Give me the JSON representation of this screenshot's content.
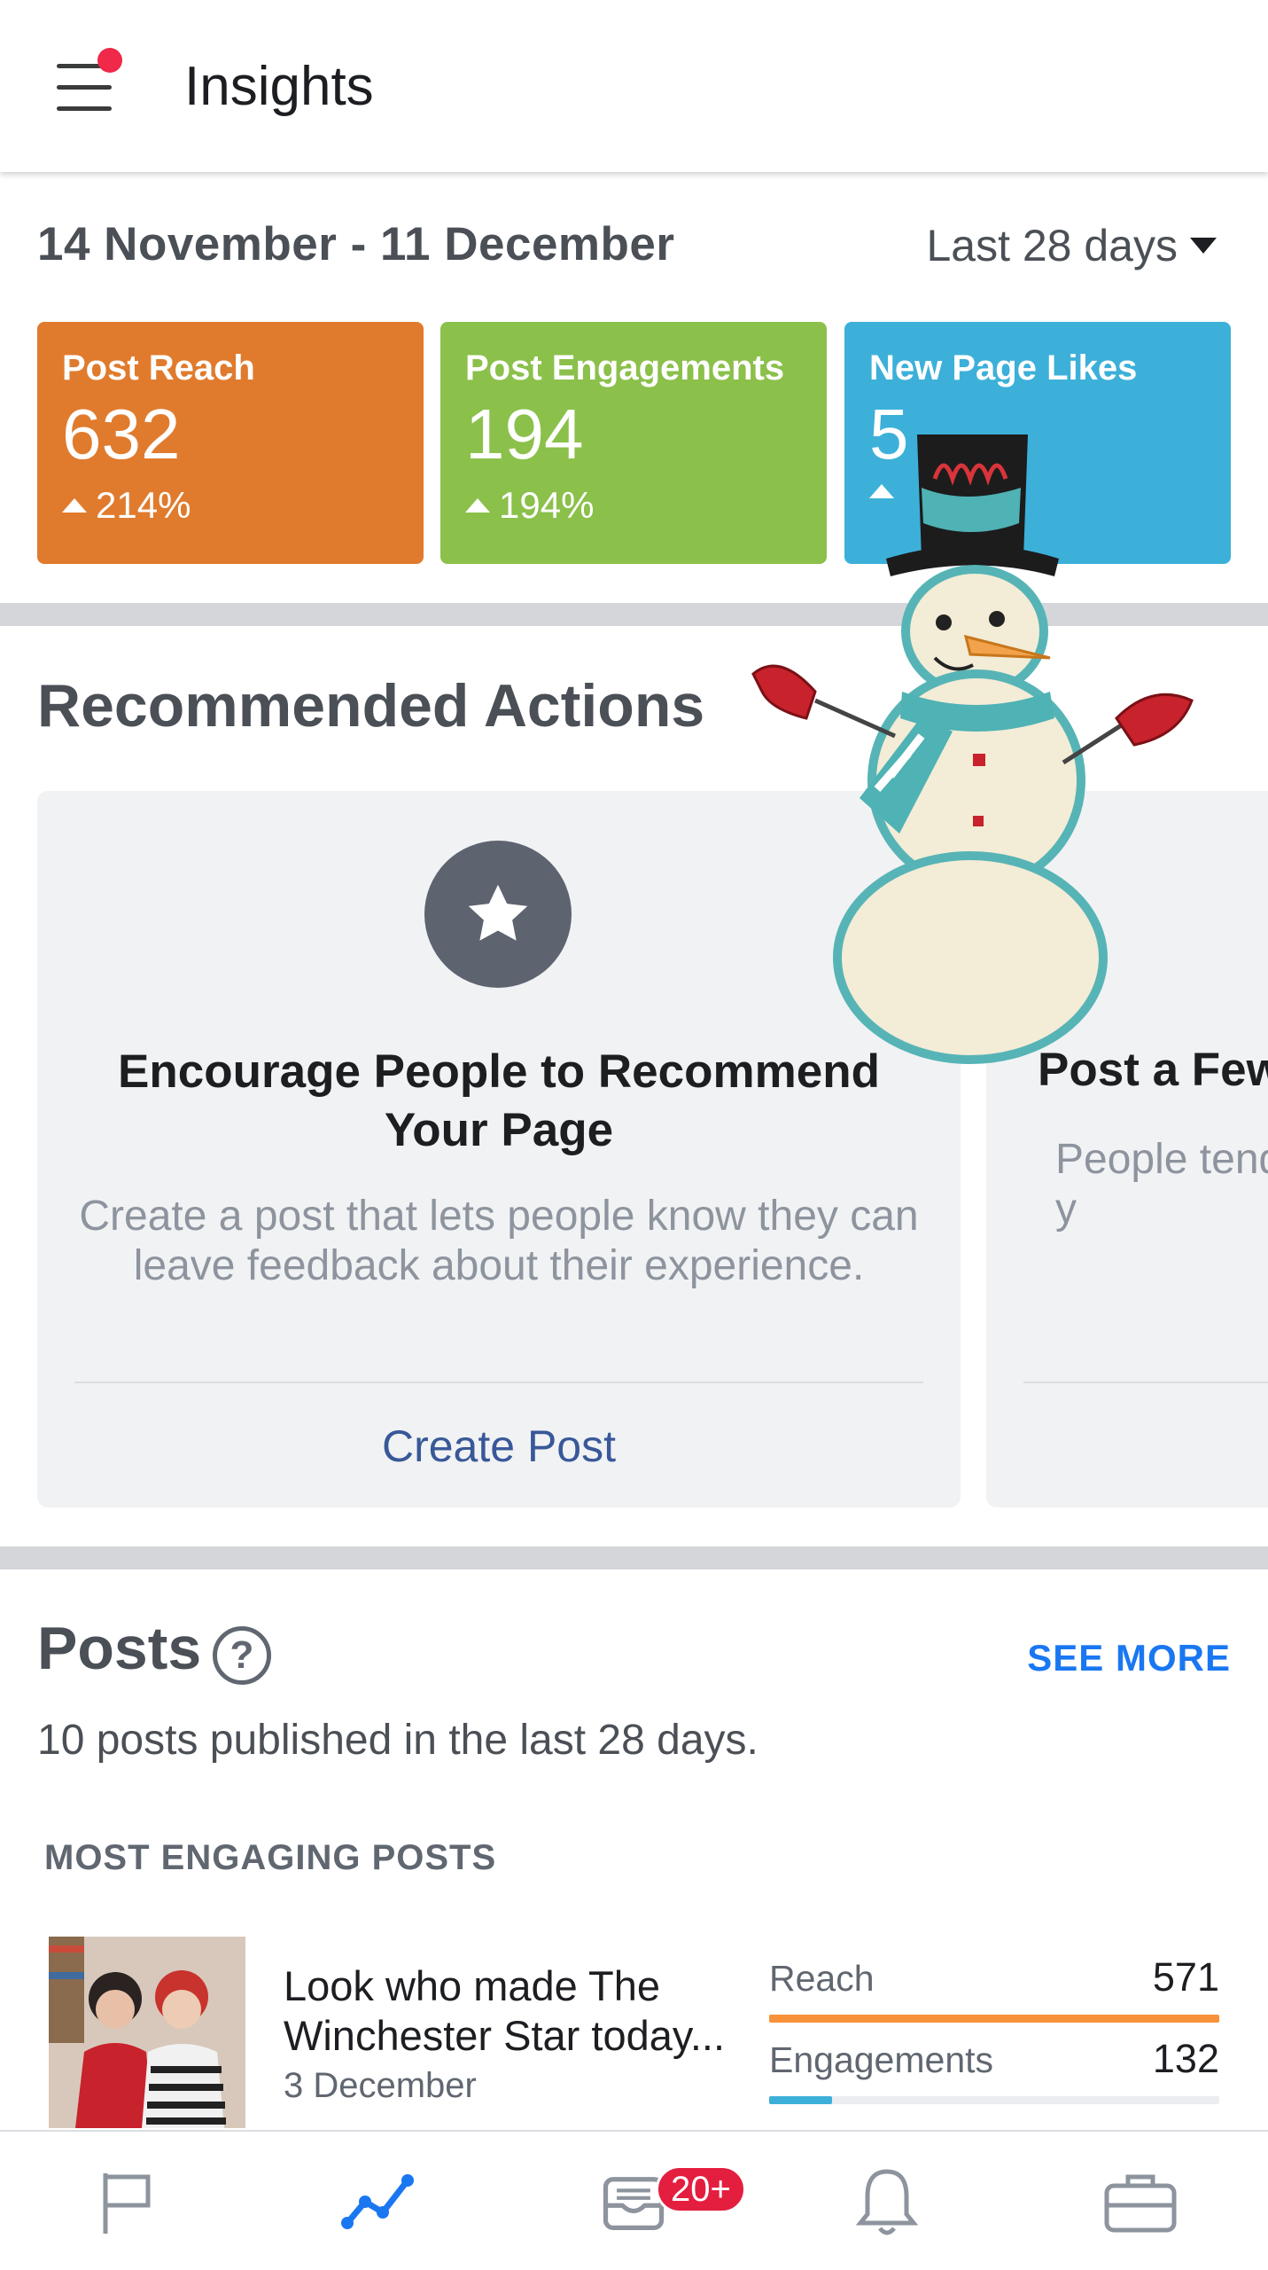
{
  "header": {
    "title": "Insights",
    "menu_icon": "hamburger-menu-icon",
    "notification_dot_color": "#f02849"
  },
  "date_range": {
    "label": "14 November - 11 December",
    "period": "Last 28 days"
  },
  "stats": [
    {
      "label": "Post Reach",
      "value": "632",
      "change": "214%",
      "color": "#e07b2e"
    },
    {
      "label": "Post Engagements",
      "value": "194",
      "change": "194%",
      "color": "#8bc04b"
    },
    {
      "label": "New Page Likes",
      "value": "5",
      "change": "",
      "color": "#3cb0d9"
    }
  ],
  "recommended": {
    "title": "Recommended Actions",
    "cards": [
      {
        "icon": "star-icon",
        "heading": "Encourage People to Recommend Your Page",
        "body": "Create a post that lets people know they can leave feedback about their experience.",
        "action": "Create Post"
      },
      {
        "heading": "Post a Few",
        "body": "People tend like y"
      }
    ]
  },
  "posts": {
    "title": "Posts",
    "see_more": "SEE MORE",
    "subtitle": "10 posts published in the last 28 days.",
    "section_header": "MOST ENGAGING POSTS",
    "items": [
      {
        "title": "Look who made The Winchester Star today...",
        "date": "3 December",
        "reach_label": "Reach",
        "reach_value": "571",
        "reach_fraction": 1.0,
        "engagements_label": "Engagements",
        "engagements_value": "132",
        "engagements_fraction": 0.14
      }
    ]
  },
  "bottom_nav": {
    "items": [
      {
        "icon": "flag-icon"
      },
      {
        "icon": "insights-graph-icon",
        "active": true
      },
      {
        "icon": "inbox-icon",
        "badge": "20+"
      },
      {
        "icon": "bell-icon"
      },
      {
        "icon": "briefcase-icon"
      }
    ]
  },
  "colors": {
    "accent": "#1a77f2",
    "link": "#385898",
    "reach_bar": "#f7923a",
    "engagement_bar": "#3cb0d9"
  }
}
